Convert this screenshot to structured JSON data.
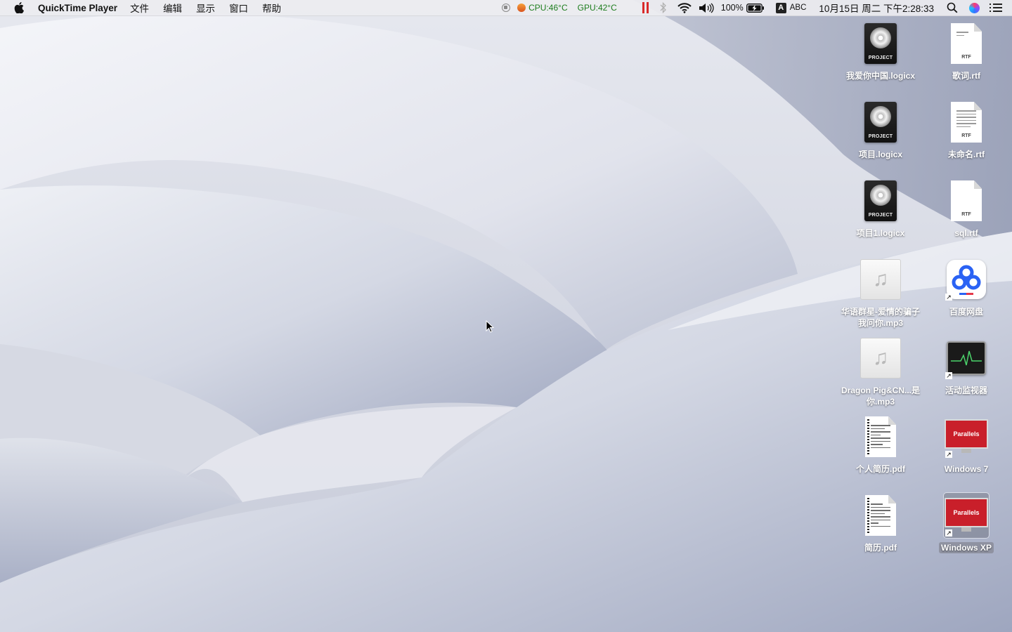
{
  "menubar": {
    "app_name": "QuickTime Player",
    "menus": [
      "文件",
      "编辑",
      "显示",
      "窗口",
      "帮助"
    ],
    "status": {
      "cpu": "CPU:46°C",
      "gpu": "GPU:42°C",
      "battery": "100%",
      "input_source": "ABC",
      "input_letter": "A",
      "clock": "10月15日 周二 下午2:28:33"
    }
  },
  "desktop_icons": [
    {
      "label": "我爱你中国.logicx",
      "kind": "logic",
      "tag": "PROJECT"
    },
    {
      "label": "歌词.rtf",
      "kind": "rtf",
      "tag": "RTF"
    },
    {
      "label": "项目.logicx",
      "kind": "logic",
      "tag": "PROJECT"
    },
    {
      "label": "未命名.rtf",
      "kind": "rtf",
      "tag": "RTF"
    },
    {
      "label": "项目1.logicx",
      "kind": "logic",
      "tag": "PROJECT"
    },
    {
      "label": "sql.rtf",
      "kind": "rtf",
      "tag": "RTF"
    },
    {
      "label": "华语群星-爱情的骗子我问你.mp3",
      "kind": "mp3"
    },
    {
      "label": "百度网盘",
      "kind": "baidu"
    },
    {
      "label": "Dragon Pig&CN...是你.mp3",
      "kind": "mp3"
    },
    {
      "label": "活动监视器",
      "kind": "activity"
    },
    {
      "label": "个人简历.pdf",
      "kind": "pdf"
    },
    {
      "label": "Windows 7",
      "kind": "parallels",
      "tag": "Parallels"
    },
    {
      "label": "简历.pdf",
      "kind": "pdf"
    },
    {
      "label": "Windows XP",
      "kind": "parallels",
      "tag": "Parallels",
      "selected": true
    }
  ],
  "colors": {
    "accent_red": "#d92a2a",
    "temp_green": "#1d7d1d",
    "parallels_red": "#c91f2a"
  }
}
